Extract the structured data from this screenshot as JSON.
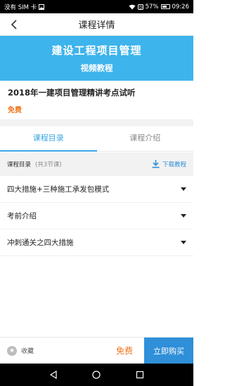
{
  "status_bar": {
    "carrier": "没有 SIM 卡",
    "battery": "57%",
    "time": "09:26"
  },
  "nav": {
    "title": "课程详情",
    "back_icon": "chevron-left-icon"
  },
  "banner": {
    "line1": "建设工程项目管理",
    "line2": "视频教程",
    "bg_color": "#3eb4ec"
  },
  "course": {
    "title": "2018年一建项目管理精讲考点试听",
    "price": "免费",
    "price_color": "#f0751e"
  },
  "tabs": [
    {
      "label": "课程目录",
      "active": true
    },
    {
      "label": "课程介绍",
      "active": false
    }
  ],
  "catalog": {
    "label": "课程目录",
    "count": "(共3节课)",
    "download_label": "下载教程",
    "download_icon": "download-icon"
  },
  "lessons": [
    {
      "label": "四大措施+三种施工承发包模式"
    },
    {
      "label": "考前介绍"
    },
    {
      "label": "冲刺通关之四大措施"
    }
  ],
  "bottom": {
    "favorite_label": "收藏",
    "favorite_icon": "star-icon",
    "price": "免费",
    "buy_label": "立即购买",
    "accent": "#2f8fd8"
  }
}
